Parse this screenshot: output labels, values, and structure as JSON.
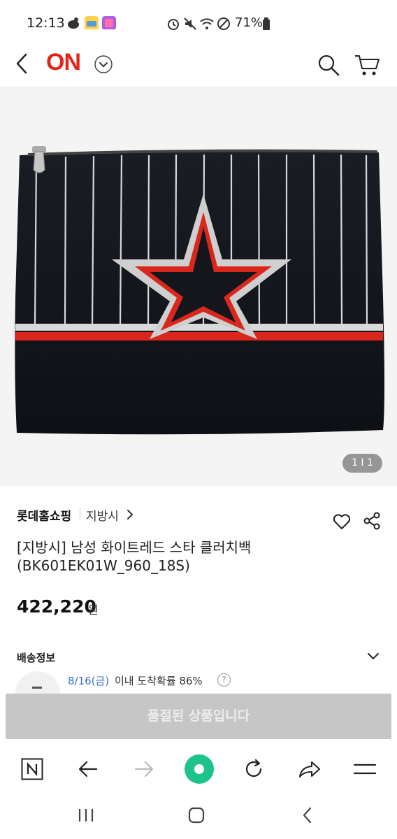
{
  "status_bar": {
    "time": "12:13",
    "battery": "71%"
  },
  "header": {
    "logo": "ON",
    "icons": [
      "back-icon",
      "chevron-down-icon",
      "search-icon",
      "cart-icon"
    ]
  },
  "product": {
    "image_counter": "1 I 1",
    "seller": "롯데홈쇼핑",
    "brand": "지방시",
    "title_line1": "[지방시] 남성 화이트레드 스타 클러치백",
    "title_line2": "(BK601EK01W_960_18S)",
    "price": "422,220",
    "currency": "원"
  },
  "delivery": {
    "label": "배송정보",
    "date": "8/16(금)",
    "text": "이내 도착확률 86%",
    "help": "?"
  },
  "soldout_button": "품절된 상품입니다",
  "colors": {
    "brand_red": "#e1251b",
    "soldout_bg": "#c6c6c6",
    "delivery_date": "#3a6fd0",
    "browser_home_green": "#1ec38b"
  }
}
